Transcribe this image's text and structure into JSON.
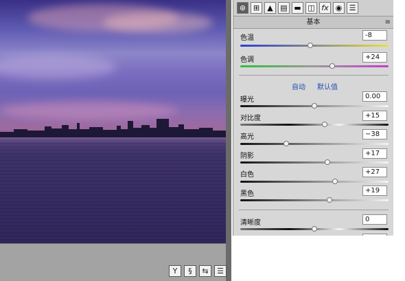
{
  "panel": {
    "section_title": "基本",
    "menu_glyph": "≡",
    "auto_label": "自动",
    "default_label": "默认值",
    "tabs": [
      {
        "name": "basic-tab-icon",
        "glyph": "⊛"
      },
      {
        "name": "tone-curve-tab-icon",
        "glyph": "⊞"
      },
      {
        "name": "detail-tab-icon",
        "glyph": "▲"
      },
      {
        "name": "hsl-tab-icon",
        "glyph": "▤"
      },
      {
        "name": "split-toning-tab-icon",
        "glyph": "▬"
      },
      {
        "name": "lens-tab-icon",
        "glyph": "◫"
      },
      {
        "name": "effects-tab-icon",
        "glyph": "fx"
      },
      {
        "name": "camera-calibration-tab-icon",
        "glyph": "◉"
      },
      {
        "name": "presets-tab-icon",
        "glyph": "☰"
      }
    ],
    "sliders": {
      "temp": {
        "label": "色温",
        "value": "-8",
        "level": 0.47
      },
      "tint": {
        "label": "色调",
        "value": "+24",
        "level": 0.62
      },
      "exposure": {
        "label": "曝光",
        "value": "0.00",
        "level": 0.5
      },
      "contrast": {
        "label": "对比度",
        "value": "+15",
        "level": 0.57
      },
      "highlights": {
        "label": "高光",
        "value": "−38",
        "level": 0.31
      },
      "shadows": {
        "label": "阴影",
        "value": "+17",
        "level": 0.59
      },
      "whites": {
        "label": "白色",
        "value": "+27",
        "level": 0.64
      },
      "blacks": {
        "label": "黑色",
        "value": "+19",
        "level": 0.6
      },
      "clarity": {
        "label": "清晰度",
        "value": "0",
        "level": 0.5
      }
    }
  },
  "bottom_bar": {
    "buttons": [
      {
        "name": "y-toggle-icon",
        "glyph": "Y"
      },
      {
        "name": "cycle-views-icon",
        "glyph": "§"
      },
      {
        "name": "swap-settings-icon",
        "glyph": "⇆"
      },
      {
        "name": "settings-sliders-icon",
        "glyph": "☰"
      }
    ]
  },
  "colors": {
    "temp_gradient_start": "#2a3fd0",
    "temp_gradient_end": "#e7e33a",
    "tint_gradient_start": "#2fbf3a",
    "tint_gradient_end": "#c43ad0",
    "link": "#1f4fb0"
  }
}
